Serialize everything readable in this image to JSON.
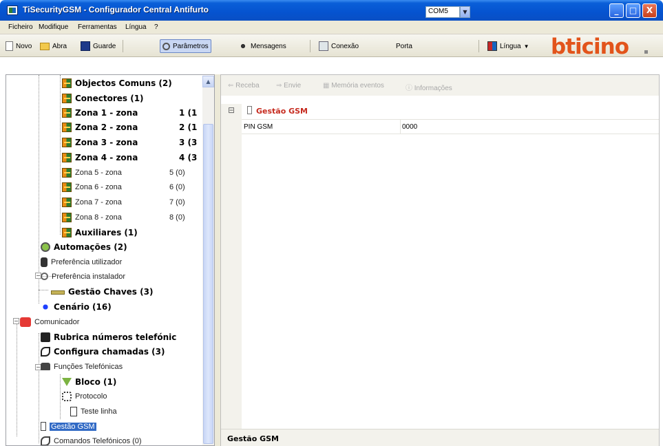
{
  "window": {
    "title": "TiSecurityGSM - Configurador Central Antifurto",
    "controls": [
      "_",
      "□",
      "X"
    ]
  },
  "menu": [
    "Ficheiro",
    "Modifique",
    "Ferramentas",
    "Língua",
    "?"
  ],
  "toolbar": {
    "novo": "Novo",
    "abra": "Abra",
    "guarde": "Guarde",
    "parametros": "Parâmetros",
    "mensagens": "Mensagens",
    "conexao": "Conexão",
    "porta_label": "Porta",
    "porta_value": "COM5",
    "lingua": "Língua",
    "logo": "bticino"
  },
  "tree": {
    "objectos": "Objectos Comuns (2)",
    "conectores": "Conectores (1)",
    "zones": [
      {
        "label": "Zona 1 - zona",
        "count": "1 (1"
      },
      {
        "label": "Zona 2 - zona",
        "count": "2 (1"
      },
      {
        "label": "Zona 3 - zona",
        "count": "3 (3"
      },
      {
        "label": "Zona 4 - zona",
        "count": "4 (3"
      },
      {
        "label": "Zona 5 - zona",
        "count": "5 (0)"
      },
      {
        "label": "Zona 6 - zona",
        "count": "6 (0)"
      },
      {
        "label": "Zona 7 - zona",
        "count": "7 (0)"
      },
      {
        "label": "Zona 8 - zona",
        "count": "8 (0)"
      }
    ],
    "auxiliares": "Auxiliares (1)",
    "automacoes": "Automações (2)",
    "pref_utilizador": "Preferência utilizador",
    "pref_instalador": "Preferência instalador",
    "gestao_chaves": "Gestão Chaves (3)",
    "cenario": "Cenário (16)",
    "comunicador": "Comunicador",
    "rubrica": "Rubrica números telefónic",
    "configura": "Configura chamadas (3)",
    "funcoes": "Funções Telefónicas",
    "bloco": "Bloco (1)",
    "protocolo": "Protocolo",
    "teste": "Teste linha",
    "gestao_gsm": "Gestão GSM",
    "comandos": "Comandos Telefónicos (0)"
  },
  "right": {
    "toolbar": {
      "receba": "Receba",
      "envie": "Envie",
      "memoria": "Memória eventos",
      "informacoes": "Informações"
    },
    "grid_title": "Gestão GSM",
    "expander": "⊟",
    "rows": [
      {
        "key": "PIN GSM",
        "value": "0000"
      }
    ],
    "description_title": "Gestão GSM"
  }
}
